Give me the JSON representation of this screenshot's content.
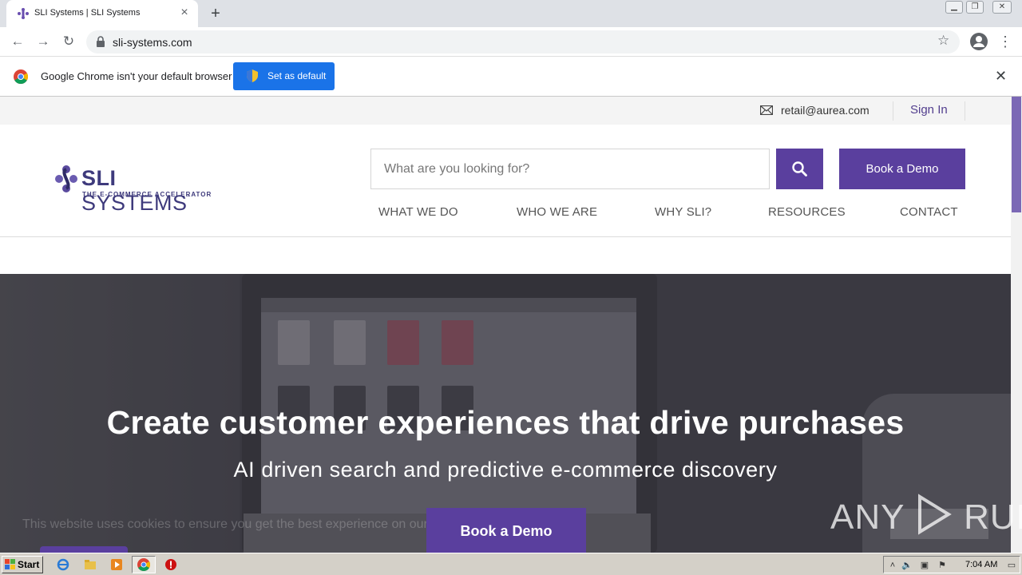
{
  "browser": {
    "tab_title": "SLI Systems | SLI Systems",
    "url": "sli-systems.com",
    "infobar_message": "Google Chrome isn't your default browser",
    "set_default_label": "Set as default"
  },
  "site": {
    "topbar": {
      "email": "retail@aurea.com",
      "sign_in": "Sign In"
    },
    "logo": {
      "name_bold": "SLI",
      "name_light": "SYSTEMS",
      "tagline": "THE E-COMMERCE ACCELERATOR"
    },
    "search": {
      "placeholder": "What are you looking for?"
    },
    "book_demo_label": "Book a Demo",
    "nav": [
      "WHAT WE DO",
      "WHO WE ARE",
      "WHY SLI?",
      "RESOURCES",
      "CONTACT"
    ],
    "hero": {
      "headline": "Create customer experiences that drive purchases",
      "subline": "AI driven search and predictive e-commerce discovery",
      "cta": "Book a Demo",
      "cookie_text": "This website uses cookies to ensure you get the best experience on our website. Learn more"
    }
  },
  "watermark": {
    "text_left": "ANY",
    "text_right": "RUN"
  },
  "taskbar": {
    "start_label": "Start",
    "clock": "7:04 AM"
  },
  "colors": {
    "brand_purple": "#5a3f9e",
    "chrome_blue": "#1a73e8",
    "logo_navy": "#3e3a7c"
  }
}
